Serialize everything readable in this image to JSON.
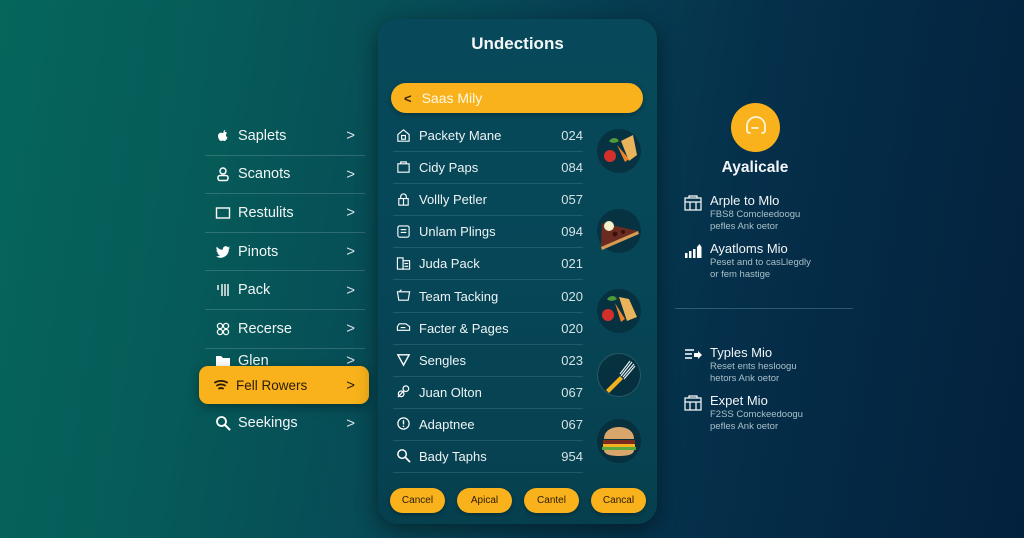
{
  "left_nav": {
    "items": [
      {
        "label": "Saplets",
        "icon": "apple-icon"
      },
      {
        "label": "Scanots",
        "icon": "user-icon"
      },
      {
        "label": "Restulits",
        "icon": "square-icon"
      },
      {
        "label": "Pinots",
        "icon": "twitter-bird-icon"
      },
      {
        "label": "Pack",
        "icon": "bars-icon"
      },
      {
        "label": "Recerse",
        "icon": "clover-icon"
      },
      {
        "label": "Glen",
        "icon": "folder-icon"
      }
    ],
    "active_item": {
      "label": "Fell Rowers",
      "icon": "wifi-icon"
    },
    "last_item": {
      "label": "Seekings",
      "icon": "search-icon"
    },
    "chevron": ">"
  },
  "panel": {
    "title": "Undections",
    "search_pill": {
      "back_glyph": "<",
      "value": "Saas Mily"
    },
    "rows": [
      {
        "label": "Packety Mane",
        "value": "024",
        "icon": "house-lock-icon"
      },
      {
        "label": "Cidy Paps",
        "value": "084",
        "icon": "clipboard-icon"
      },
      {
        "label": "Vollly Petler",
        "value": "057",
        "icon": "lock-group-icon"
      },
      {
        "label": "Unlam Plings",
        "value": "094",
        "icon": "document-stack-icon"
      },
      {
        "label": "Juda Pack",
        "value": "021",
        "icon": "files-icon"
      },
      {
        "label": "Team Tacking",
        "value": "020",
        "icon": "basket-icon"
      },
      {
        "label": "Facter & Pages",
        "value": "020",
        "icon": "car-icon"
      },
      {
        "label": "Sengles",
        "value": "023",
        "icon": "triangle-down-icon"
      },
      {
        "label": "Juan Olton",
        "value": "067",
        "icon": "link-icon"
      },
      {
        "label": "Adaptnee",
        "value": "067",
        "icon": "alert-circle-icon"
      },
      {
        "label": "Bady Taphs",
        "value": "954",
        "icon": "search-icon"
      }
    ],
    "food_images": [
      "vegetables-image",
      "pizza-slice-image",
      "vegetables-image",
      "fork-image",
      "burger-image"
    ],
    "buttons": [
      "Cancel",
      "Apical",
      "Cantel",
      "Cancal"
    ]
  },
  "right_panel": {
    "avatar_icon": "headset-icon",
    "title": "Ayalicale",
    "features": [
      {
        "title": "Arple to Mlo",
        "desc1": "FBS8 Comcleedoogu",
        "desc2": "pefles Ank oetor",
        "icon": "calendar-grid-icon"
      },
      {
        "title": "Ayatloms Mio",
        "desc1": "Peset and to casLlegdly",
        "desc2": "or fem hastige",
        "icon": "signal-bars-icon"
      },
      {
        "title": "Typles Mio",
        "desc1": "Reset ents hesloogu",
        "desc2": "hetors Ank oetor",
        "icon": "list-arrow-icon"
      },
      {
        "title": "Expet Mio",
        "desc1": "F2SS Comckeedoogu",
        "desc2": "pefles Ank oetor",
        "icon": "calendar-grid-icon"
      }
    ]
  },
  "colors": {
    "accent": "#f9b21b",
    "panel_bg": "#07495a",
    "bg_left": "#05665c",
    "bg_right": "#03213d"
  }
}
